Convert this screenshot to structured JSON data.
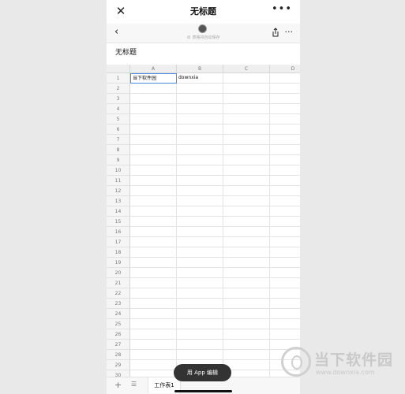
{
  "nav": {
    "title": "无标题",
    "close_icon": "close-icon",
    "more_icon": "more-icon"
  },
  "toolbar": {
    "status": "表格将自动保存",
    "back_icon": "back-icon",
    "share_icon": "share-icon",
    "more_icon": "more-icon"
  },
  "doc": {
    "title": "无标题"
  },
  "grid": {
    "columns": [
      "A",
      "B",
      "C",
      "D"
    ],
    "rows": [
      "1",
      "2",
      "3",
      "4",
      "5",
      "6",
      "7",
      "8",
      "9",
      "10",
      "11",
      "12",
      "13",
      "14",
      "15",
      "16",
      "17",
      "18",
      "19",
      "20",
      "21",
      "22",
      "23",
      "24",
      "25",
      "26",
      "27",
      "28",
      "29",
      "30"
    ],
    "cells": [
      {
        "row": 0,
        "col": 0,
        "value": "当下软件园",
        "active": true
      },
      {
        "row": 0,
        "col": 1,
        "value": "downxia"
      }
    ]
  },
  "bottom": {
    "sheet_tab": "工作表1",
    "add_icon": "plus-icon",
    "list_icon": "list-icon"
  },
  "edit_button": {
    "label": "用 App 编辑"
  },
  "watermark": {
    "text": "当下软件园",
    "url": "www.downxia.com"
  }
}
